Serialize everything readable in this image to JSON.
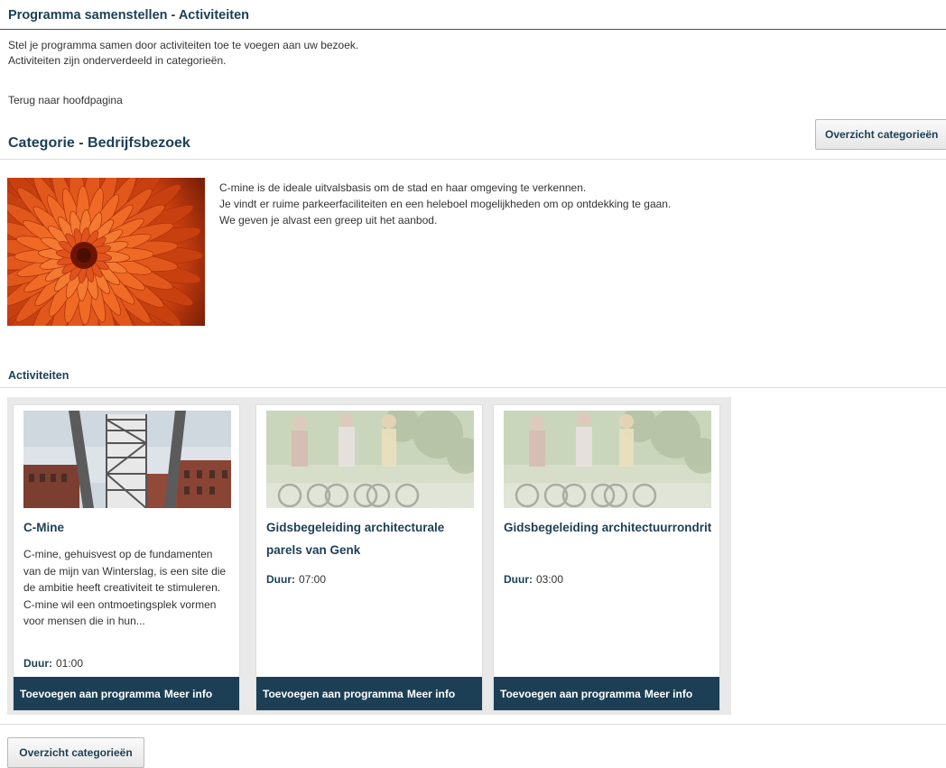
{
  "header": {
    "title": "Programma samenstellen - Activiteiten",
    "intro_line1": "Stel je programma samen door activiteiten toe te voegen aan uw bezoek.",
    "intro_line2": "Activiteiten zijn onderverdeeld in categorieën.",
    "back_link": "Terug naar hoofdpagina"
  },
  "category": {
    "overview_button": "Overzicht categorieën",
    "title": "Categorie - Bedrijfsbezoek",
    "desc_line1": "C-mine is de ideale uitvalsbasis om de stad en haar omgeving te verkennen.",
    "desc_line2": "Je vindt er ruime parkeerfaciliteiten en een heleboel mogelijkheden om op ontdekking te gaan.",
    "desc_line3": "We geven je alvast een greep uit het aanbod.",
    "image_icon": "flower-image"
  },
  "activities": {
    "title": "Activiteiten",
    "duration_label": "Duur:",
    "add_label": "Toevoegen aan programma",
    "more_label": "Meer info",
    "cards": [
      {
        "title": "C-Mine",
        "description": "C-mine, gehuisvest op de fundamenten van de mijn van Winterslag, is een site die de ambitie heeft creativiteit te stimuleren. C-mine wil een ontmoetingsplek vormen voor mensen die in hun...",
        "duration": "01:00",
        "image_icon": "mine-tower-image"
      },
      {
        "title": "Gidsbegeleiding architecturale parels van Genk",
        "description": "",
        "duration": "07:00",
        "image_icon": "cyclists-image"
      },
      {
        "title": "Gidsbegeleiding architectuurrondrit",
        "description": "",
        "duration": "03:00",
        "image_icon": "cyclists-image"
      }
    ]
  },
  "footer": {
    "overview_button": "Overzicht categorieën"
  },
  "colors": {
    "brand": "#1c3f55",
    "accent_flower": "#e8531a"
  }
}
